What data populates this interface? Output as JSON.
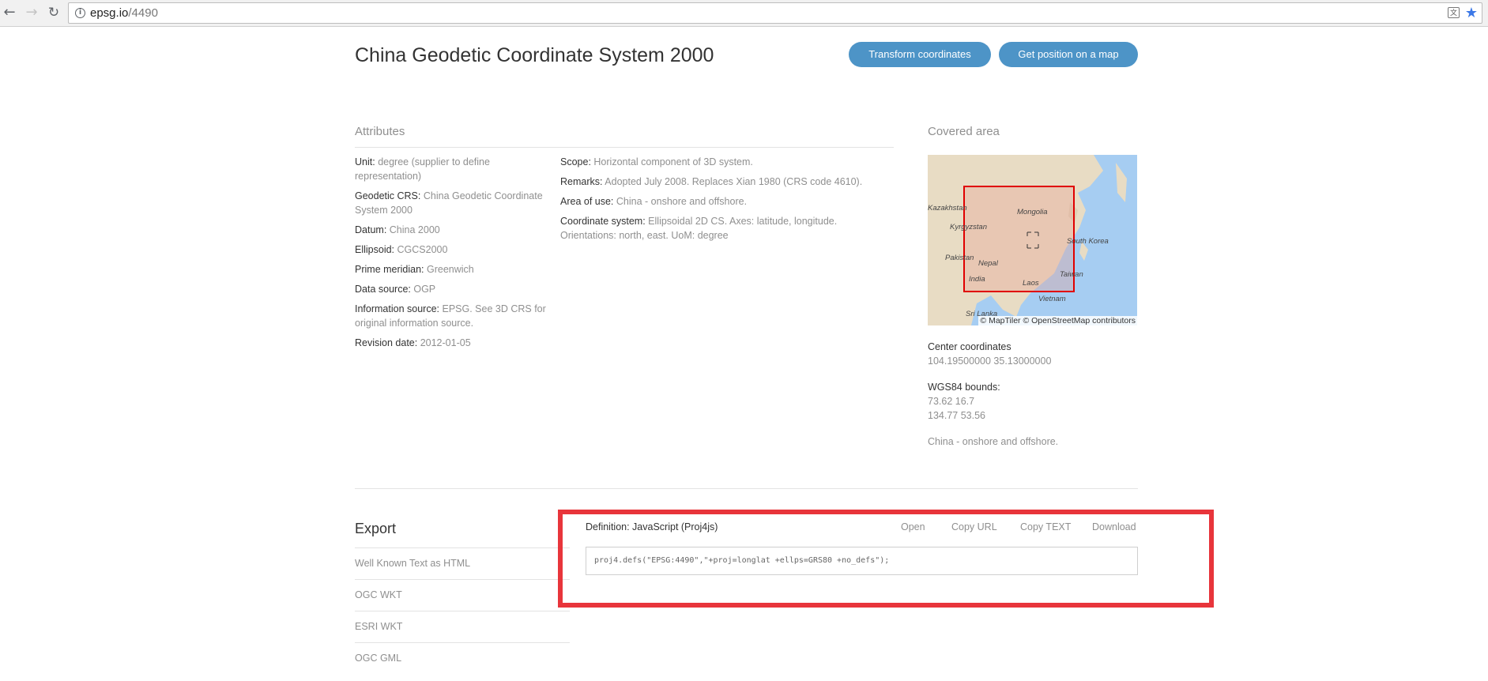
{
  "browser": {
    "url_host": "epsg.io",
    "url_path": "/4490",
    "icons": [
      "back-arrow-icon",
      "forward-arrow-icon",
      "reload-icon",
      "info-icon",
      "translate-icon",
      "star-icon"
    ]
  },
  "page": {
    "title": "China Geodetic Coordinate System 2000",
    "buttons": {
      "transform": "Transform coordinates",
      "map": "Get position on a map"
    }
  },
  "attributes": {
    "heading": "Attributes",
    "left": [
      {
        "label": "Unit:",
        "value": "degree (supplier to define representation)"
      },
      {
        "label": "Geodetic CRS:",
        "value": "China Geodetic Coordinate System 2000"
      },
      {
        "label": "Datum:",
        "value": "China 2000"
      },
      {
        "label": "Ellipsoid:",
        "value": "CGCS2000"
      },
      {
        "label": "Prime meridian:",
        "value": "Greenwich"
      },
      {
        "label": "Data source:",
        "value": "OGP"
      },
      {
        "label": "Information source:",
        "value": "EPSG. See 3D CRS for original information source."
      },
      {
        "label": "Revision date:",
        "value": "2012-01-05"
      }
    ],
    "right": [
      {
        "label": "Scope:",
        "value": "Horizontal component of 3D system."
      },
      {
        "label": "Remarks:",
        "value": "Adopted July 2008. Replaces Xian 1980 (CRS code 4610)."
      },
      {
        "label": "Area of use:",
        "value": "China - onshore and offshore."
      },
      {
        "label": "Coordinate system:",
        "value": "Ellipsoidal 2D CS. Axes: latitude, longitude. Orientations: north, east. UoM: degree"
      }
    ]
  },
  "covered_area": {
    "heading": "Covered area",
    "map_labels": [
      "Kazakhstan",
      "Mongolia",
      "Kyrgyzstan",
      "South Korea",
      "Pakistan",
      "Nepal",
      "India",
      "Laos",
      "Taiwan",
      "Vietnam",
      "Sri Lanka"
    ],
    "map_credit": "© MapTiler © OpenStreetMap contributors",
    "center_label": "Center coordinates",
    "center_value": "104.19500000 35.13000000",
    "bounds_label": "WGS84 bounds:",
    "bounds_line1": "73.62 16.7",
    "bounds_line2": "134.77 53.56",
    "description": "China - onshore and offshore.",
    "colors": {
      "sea": "#a6cdf2",
      "land": "#e8dcc4",
      "bbox": "#e00000"
    }
  },
  "export": {
    "heading": "Export",
    "items": [
      "Well Known Text as HTML",
      "OGC WKT",
      "ESRI WKT",
      "OGC GML"
    ]
  },
  "definition": {
    "label": "Definition: JavaScript (Proj4js)",
    "links": {
      "open": "Open",
      "copy_url": "Copy URL",
      "copy_text": "Copy TEXT",
      "download": "Download"
    },
    "code": "proj4.defs(\"EPSG:4490\",\"+proj=longlat +ellps=GRS80 +no_defs\");",
    "highlight_color": "#e8353b"
  }
}
